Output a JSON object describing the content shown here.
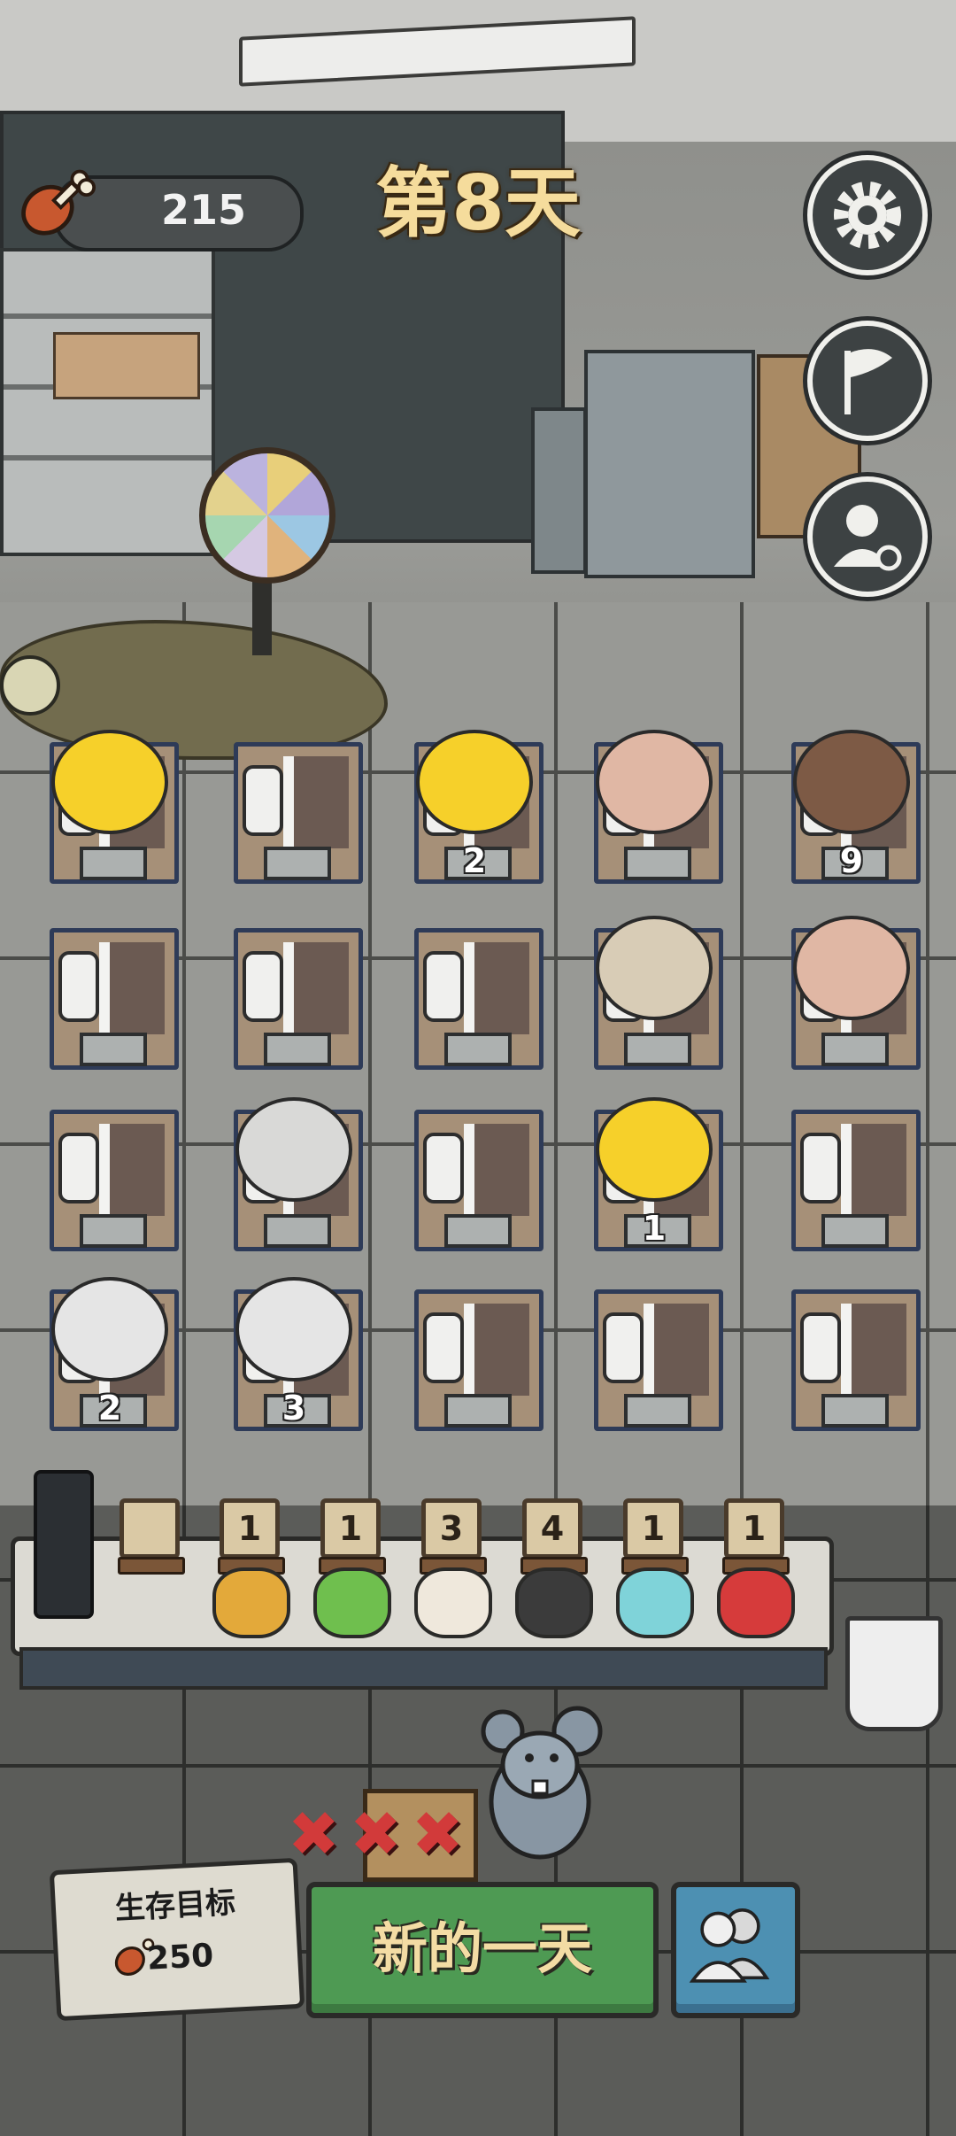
{
  "hud": {
    "food_count": "215",
    "day_title": "第8天"
  },
  "grid": {
    "rows": [
      [
        {
          "occupant": "duck-mask-girl",
          "count": ""
        },
        {
          "occupant": "empty",
          "count": ""
        },
        {
          "occupant": "duck",
          "count": "2"
        },
        {
          "occupant": "pink-hair-girl",
          "count": ""
        },
        {
          "occupant": "bearded-man",
          "count": "9"
        }
      ],
      [
        {
          "occupant": "empty",
          "count": ""
        },
        {
          "occupant": "empty",
          "count": ""
        },
        {
          "occupant": "empty",
          "count": ""
        },
        {
          "occupant": "blonde-girl",
          "count": ""
        },
        {
          "occupant": "pink-hair-girl",
          "count": ""
        }
      ],
      [
        {
          "occupant": "empty",
          "count": ""
        },
        {
          "occupant": "robot",
          "count": ""
        },
        {
          "occupant": "empty",
          "count": ""
        },
        {
          "occupant": "duck",
          "count": "1"
        },
        {
          "occupant": "empty",
          "count": ""
        }
      ],
      [
        {
          "occupant": "silver-hair",
          "count": "2"
        },
        {
          "occupant": "silver-hair",
          "count": "3"
        },
        {
          "occupant": "empty",
          "count": ""
        },
        {
          "occupant": "empty",
          "count": ""
        },
        {
          "occupant": "empty",
          "count": ""
        }
      ]
    ]
  },
  "inventory": {
    "slots": [
      {
        "item": "empty",
        "count": ""
      },
      {
        "item": "wheat-icon",
        "count": "1"
      },
      {
        "item": "frog-icon",
        "count": "1"
      },
      {
        "item": "egg-icon",
        "count": "3"
      },
      {
        "item": "boot-icon",
        "count": "4"
      },
      {
        "item": "tissue-box-icon",
        "count": "1"
      },
      {
        "item": "red-crystal-icon",
        "count": "1"
      }
    ]
  },
  "bottom": {
    "goal_label": "生存目标",
    "goal_value": "250",
    "new_day_label": "新的一天"
  },
  "colors": {
    "day_title": "#f5dc9c",
    "new_day_button": "#4e9a53",
    "team_button": "#4d90b2",
    "strike_x": "#d23a3a"
  }
}
